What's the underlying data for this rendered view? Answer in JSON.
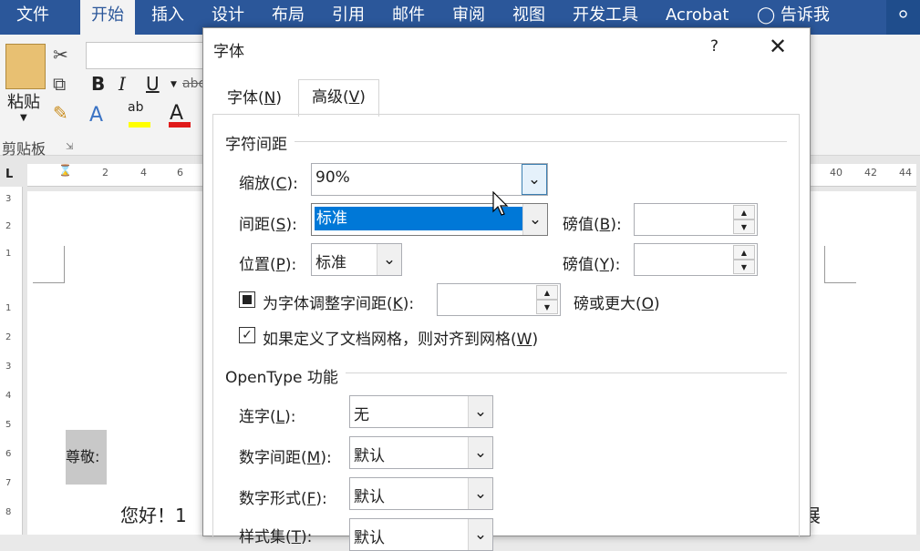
{
  "ribbon": {
    "tabs": [
      "文件",
      "开始",
      "插入",
      "设计",
      "布局",
      "引用",
      "邮件",
      "审阅",
      "视图",
      "开发工具",
      "Acrobat"
    ],
    "active_tab": "开始",
    "tell_me": "告诉我",
    "paste_label": "粘贴",
    "clipboard_label": "剪贴板",
    "strike_label": "abc"
  },
  "document": {
    "body_text_left": "您好！1",
    "body_text_right": "展",
    "side_text": "尊敬:",
    "ruler_left": [
      "2",
      "4",
      "6"
    ],
    "ruler_right": [
      "40",
      "42",
      "44"
    ],
    "vruler": [
      "3",
      "2",
      "1",
      "1",
      "2",
      "3",
      "4",
      "5",
      "6",
      "7",
      "8"
    ]
  },
  "dialog": {
    "title": "字体",
    "help": "?",
    "tabs": [
      {
        "label": "字体(",
        "key": "N",
        "suffix": ")"
      },
      {
        "label": "高级(",
        "key": "V",
        "suffix": ")"
      }
    ],
    "active_tab": "高级(V)",
    "section_spacing": "字符间距",
    "scale": {
      "label": "缩放(",
      "key": "C",
      "suffix": "):",
      "value": "90%"
    },
    "spacing": {
      "label": "间距(",
      "key": "S",
      "suffix": "):",
      "value": "标准",
      "pts_label": "磅值(",
      "pts_key": "B",
      "pts_suffix": "):",
      "pts_value": ""
    },
    "position": {
      "label": "位置(",
      "key": "P",
      "suffix": "):",
      "value": "标准",
      "pts_label": "磅值(",
      "pts_key": "Y",
      "pts_suffix": "):",
      "pts_value": ""
    },
    "kerning": {
      "label": "为字体调整字间距(",
      "key": "K",
      "suffix": "):",
      "value": "",
      "after": "磅或更大(",
      "after_key": "O",
      "after_suffix": ")",
      "state": "indeterminate"
    },
    "grid": {
      "label": "如果定义了文档网格，则对齐到网格(",
      "key": "W",
      "suffix": ")",
      "checked": true
    },
    "section_opentype": "OpenType 功能",
    "ligatures": {
      "label": "连字(",
      "key": "L",
      "suffix": "):",
      "value": "无"
    },
    "num_spacing": {
      "label": "数字间距(",
      "key": "M",
      "suffix": "):",
      "value": "默认"
    },
    "num_forms": {
      "label": "数字形式(",
      "key": "F",
      "suffix": "):",
      "value": "默认"
    },
    "style_sets": {
      "label": "样式集(",
      "key": "T",
      "suffix": "):",
      "value": "默认"
    }
  },
  "colors": {
    "ribbon_blue": "#2b579a",
    "selection": "#0078d7"
  }
}
